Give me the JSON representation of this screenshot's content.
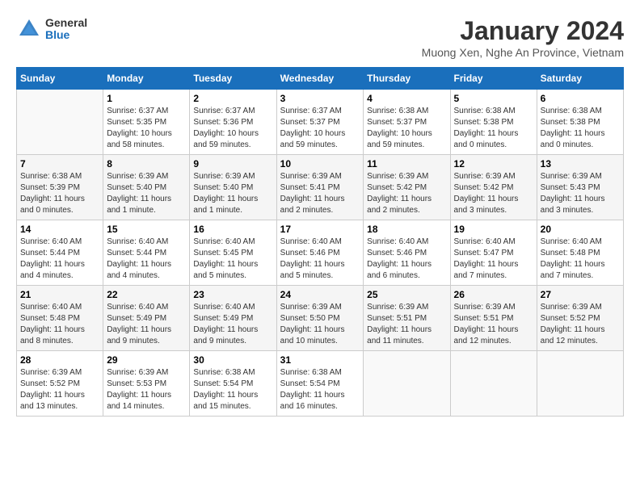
{
  "header": {
    "logo_general": "General",
    "logo_blue": "Blue",
    "month_year": "January 2024",
    "location": "Muong Xen, Nghe An Province, Vietnam"
  },
  "days_of_week": [
    "Sunday",
    "Monday",
    "Tuesday",
    "Wednesday",
    "Thursday",
    "Friday",
    "Saturday"
  ],
  "weeks": [
    [
      {
        "date": "",
        "sunrise": "",
        "sunset": "",
        "daylight": ""
      },
      {
        "date": "1",
        "sunrise": "Sunrise: 6:37 AM",
        "sunset": "Sunset: 5:35 PM",
        "daylight": "Daylight: 10 hours and 58 minutes."
      },
      {
        "date": "2",
        "sunrise": "Sunrise: 6:37 AM",
        "sunset": "Sunset: 5:36 PM",
        "daylight": "Daylight: 10 hours and 59 minutes."
      },
      {
        "date": "3",
        "sunrise": "Sunrise: 6:37 AM",
        "sunset": "Sunset: 5:37 PM",
        "daylight": "Daylight: 10 hours and 59 minutes."
      },
      {
        "date": "4",
        "sunrise": "Sunrise: 6:38 AM",
        "sunset": "Sunset: 5:37 PM",
        "daylight": "Daylight: 10 hours and 59 minutes."
      },
      {
        "date": "5",
        "sunrise": "Sunrise: 6:38 AM",
        "sunset": "Sunset: 5:38 PM",
        "daylight": "Daylight: 11 hours and 0 minutes."
      },
      {
        "date": "6",
        "sunrise": "Sunrise: 6:38 AM",
        "sunset": "Sunset: 5:38 PM",
        "daylight": "Daylight: 11 hours and 0 minutes."
      }
    ],
    [
      {
        "date": "7",
        "sunrise": "Sunrise: 6:38 AM",
        "sunset": "Sunset: 5:39 PM",
        "daylight": "Daylight: 11 hours and 0 minutes."
      },
      {
        "date": "8",
        "sunrise": "Sunrise: 6:39 AM",
        "sunset": "Sunset: 5:40 PM",
        "daylight": "Daylight: 11 hours and 1 minute."
      },
      {
        "date": "9",
        "sunrise": "Sunrise: 6:39 AM",
        "sunset": "Sunset: 5:40 PM",
        "daylight": "Daylight: 11 hours and 1 minute."
      },
      {
        "date": "10",
        "sunrise": "Sunrise: 6:39 AM",
        "sunset": "Sunset: 5:41 PM",
        "daylight": "Daylight: 11 hours and 2 minutes."
      },
      {
        "date": "11",
        "sunrise": "Sunrise: 6:39 AM",
        "sunset": "Sunset: 5:42 PM",
        "daylight": "Daylight: 11 hours and 2 minutes."
      },
      {
        "date": "12",
        "sunrise": "Sunrise: 6:39 AM",
        "sunset": "Sunset: 5:42 PM",
        "daylight": "Daylight: 11 hours and 3 minutes."
      },
      {
        "date": "13",
        "sunrise": "Sunrise: 6:39 AM",
        "sunset": "Sunset: 5:43 PM",
        "daylight": "Daylight: 11 hours and 3 minutes."
      }
    ],
    [
      {
        "date": "14",
        "sunrise": "Sunrise: 6:40 AM",
        "sunset": "Sunset: 5:44 PM",
        "daylight": "Daylight: 11 hours and 4 minutes."
      },
      {
        "date": "15",
        "sunrise": "Sunrise: 6:40 AM",
        "sunset": "Sunset: 5:44 PM",
        "daylight": "Daylight: 11 hours and 4 minutes."
      },
      {
        "date": "16",
        "sunrise": "Sunrise: 6:40 AM",
        "sunset": "Sunset: 5:45 PM",
        "daylight": "Daylight: 11 hours and 5 minutes."
      },
      {
        "date": "17",
        "sunrise": "Sunrise: 6:40 AM",
        "sunset": "Sunset: 5:46 PM",
        "daylight": "Daylight: 11 hours and 5 minutes."
      },
      {
        "date": "18",
        "sunrise": "Sunrise: 6:40 AM",
        "sunset": "Sunset: 5:46 PM",
        "daylight": "Daylight: 11 hours and 6 minutes."
      },
      {
        "date": "19",
        "sunrise": "Sunrise: 6:40 AM",
        "sunset": "Sunset: 5:47 PM",
        "daylight": "Daylight: 11 hours and 7 minutes."
      },
      {
        "date": "20",
        "sunrise": "Sunrise: 6:40 AM",
        "sunset": "Sunset: 5:48 PM",
        "daylight": "Daylight: 11 hours and 7 minutes."
      }
    ],
    [
      {
        "date": "21",
        "sunrise": "Sunrise: 6:40 AM",
        "sunset": "Sunset: 5:48 PM",
        "daylight": "Daylight: 11 hours and 8 minutes."
      },
      {
        "date": "22",
        "sunrise": "Sunrise: 6:40 AM",
        "sunset": "Sunset: 5:49 PM",
        "daylight": "Daylight: 11 hours and 9 minutes."
      },
      {
        "date": "23",
        "sunrise": "Sunrise: 6:40 AM",
        "sunset": "Sunset: 5:49 PM",
        "daylight": "Daylight: 11 hours and 9 minutes."
      },
      {
        "date": "24",
        "sunrise": "Sunrise: 6:39 AM",
        "sunset": "Sunset: 5:50 PM",
        "daylight": "Daylight: 11 hours and 10 minutes."
      },
      {
        "date": "25",
        "sunrise": "Sunrise: 6:39 AM",
        "sunset": "Sunset: 5:51 PM",
        "daylight": "Daylight: 11 hours and 11 minutes."
      },
      {
        "date": "26",
        "sunrise": "Sunrise: 6:39 AM",
        "sunset": "Sunset: 5:51 PM",
        "daylight": "Daylight: 11 hours and 12 minutes."
      },
      {
        "date": "27",
        "sunrise": "Sunrise: 6:39 AM",
        "sunset": "Sunset: 5:52 PM",
        "daylight": "Daylight: 11 hours and 12 minutes."
      }
    ],
    [
      {
        "date": "28",
        "sunrise": "Sunrise: 6:39 AM",
        "sunset": "Sunset: 5:52 PM",
        "daylight": "Daylight: 11 hours and 13 minutes."
      },
      {
        "date": "29",
        "sunrise": "Sunrise: 6:39 AM",
        "sunset": "Sunset: 5:53 PM",
        "daylight": "Daylight: 11 hours and 14 minutes."
      },
      {
        "date": "30",
        "sunrise": "Sunrise: 6:38 AM",
        "sunset": "Sunset: 5:54 PM",
        "daylight": "Daylight: 11 hours and 15 minutes."
      },
      {
        "date": "31",
        "sunrise": "Sunrise: 6:38 AM",
        "sunset": "Sunset: 5:54 PM",
        "daylight": "Daylight: 11 hours and 16 minutes."
      },
      {
        "date": "",
        "sunrise": "",
        "sunset": "",
        "daylight": ""
      },
      {
        "date": "",
        "sunrise": "",
        "sunset": "",
        "daylight": ""
      },
      {
        "date": "",
        "sunrise": "",
        "sunset": "",
        "daylight": ""
      }
    ]
  ]
}
